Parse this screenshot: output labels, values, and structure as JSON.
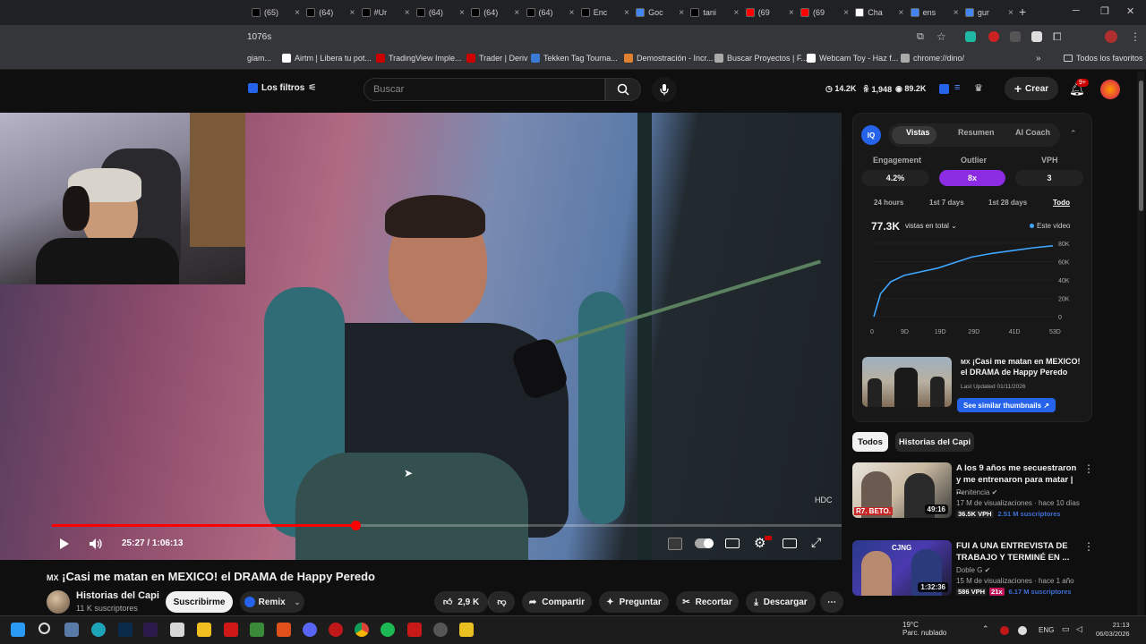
{
  "browser": {
    "tabs": [
      {
        "label": "(65)",
        "icon": "tiktok-icon",
        "color": "#000000"
      },
      {
        "label": "(64)",
        "icon": "tiktok-icon",
        "color": "#000000"
      },
      {
        "label": "#Ur",
        "icon": "tiktok-icon",
        "color": "#000000"
      },
      {
        "label": "(64)",
        "icon": "tiktok-icon",
        "color": "#000000"
      },
      {
        "label": "(64)",
        "icon": "tiktok-icon",
        "color": "#000000"
      },
      {
        "label": "(64)",
        "icon": "tiktok-icon",
        "color": "#000000"
      },
      {
        "label": "Enc",
        "icon": "tiktok-icon",
        "color": "#000000"
      },
      {
        "label": "Goc",
        "icon": "google-icon",
        "color": "#4285f4"
      },
      {
        "label": "tani",
        "icon": "tiktok-icon",
        "color": "#000000"
      },
      {
        "label": "(69",
        "icon": "youtube-icon",
        "color": "#ff0000"
      },
      {
        "label": "(69",
        "icon": "youtube-icon",
        "color": "#ff0000"
      },
      {
        "label": "Cha",
        "icon": "chatgpt-icon",
        "color": "#ffffff"
      },
      {
        "label": "ens",
        "icon": "google-icon",
        "color": "#4285f4"
      },
      {
        "label": "gur",
        "icon": "google-icon",
        "color": "#4285f4"
      }
    ],
    "url": "1076s",
    "bookmarks": [
      {
        "label": "giam...",
        "color": "#888888"
      },
      {
        "label": "Airtm | Libera tu pot...",
        "color": "#ffffff"
      },
      {
        "label": "TradingView Imple...",
        "color": "#cc0000"
      },
      {
        "label": "Trader | Deriv",
        "color": "#cc0000"
      },
      {
        "label": "Tekken Tag Tourna...",
        "color": "#3a7bd5"
      },
      {
        "label": "Demostración - Incr...",
        "color": "#e08030"
      },
      {
        "label": "Buscar Proyectos | F...",
        "color": "#aaaaaa"
      },
      {
        "label": "Webcam Toy - Haz f...",
        "color": "#ffffff"
      },
      {
        "label": "chrome://dino/",
        "color": "#aaaaaa"
      }
    ],
    "bookmarks_all": "Todos los favoritos"
  },
  "header": {
    "filters_label": "Los filtros",
    "search_placeholder": "Buscar",
    "stats": [
      "14.2K",
      "1,948",
      "89.2K"
    ],
    "create_label": "Crear",
    "notif_count": "9+"
  },
  "player": {
    "current_time": "25:27",
    "duration": "1:06:13",
    "progress": 0.384,
    "hdc": "HDC"
  },
  "video": {
    "flag": "MX",
    "title": "¡Casi me matan en MEXICO! el DRAMA de Happy Peredo",
    "channel": "Historias del Capi",
    "subs": "11 K suscriptores",
    "subscribe": "Suscribirme",
    "remix": "Remix",
    "likes": "2,9 K",
    "share": "Compartir",
    "ask": "Preguntar",
    "clip": "Recortar",
    "download": "Descargar"
  },
  "vidiq": {
    "tabs": [
      "Vistas",
      "Resumen",
      "AI Coach"
    ],
    "metrics": [
      {
        "label": "Engagement",
        "value": "4.2%"
      },
      {
        "label": "Outlier",
        "value": "8x"
      },
      {
        "label": "VPH",
        "value": "3"
      }
    ],
    "ranges": [
      "24 hours",
      "1st 7 days",
      "1st 28 days",
      "Todo"
    ],
    "views_total": "77.3K",
    "views_select": "vistas en total",
    "legend": "Este video",
    "card_title": "¡Casi me matan en MEXICO! el DRAMA de Happy Peredo",
    "card_flag": "MX",
    "card_updated": "Last Updated 01/11/2026",
    "card_button": "See similar thumbnails"
  },
  "chart_data": {
    "type": "line",
    "x_ticks": [
      "0",
      "9D",
      "19D",
      "29D",
      "41D",
      "53D"
    ],
    "y_ticks": [
      "80K",
      "60K",
      "40K",
      "20K",
      "0"
    ],
    "ylim": [
      0,
      80000
    ],
    "series": [
      {
        "name": "Este video",
        "x": [
          0,
          2,
          5,
          9,
          14,
          19,
          24,
          29,
          35,
          41,
          47,
          53
        ],
        "y": [
          0,
          25000,
          38000,
          45000,
          49000,
          53000,
          59000,
          65000,
          69000,
          72000,
          75000,
          77300
        ]
      }
    ]
  },
  "chips": [
    "Todos",
    "Historias del Capi"
  ],
  "recommendations": [
    {
      "title": "A los 9 años me secuestraron y me entrenaron para matar | ...",
      "channel": "Penitencia",
      "meta": "17 M de visualizaciones · hace 10 días",
      "vph": "36.5K VPH",
      "extra": "",
      "subs": "2.51 M suscriptores",
      "duration": "49:16",
      "thumb_text": "R7. BETO."
    },
    {
      "title": "FUI A UNA ENTREVISTA DE TRABAJO Y TERMINÉ EN ...",
      "channel": "Doble G",
      "meta": "15 M de visualizaciones · hace 1 año",
      "vph": "586 VPH",
      "extra": "21x",
      "subs": "6.17 M suscriptores",
      "duration": "1:32:36",
      "thumb_text": "CJNG"
    }
  ],
  "taskbar": {
    "weather_temp": "19°C",
    "weather_desc": "Parc. nublado",
    "lang": "ENG",
    "time": "21:13",
    "date": "06/03/2026"
  }
}
